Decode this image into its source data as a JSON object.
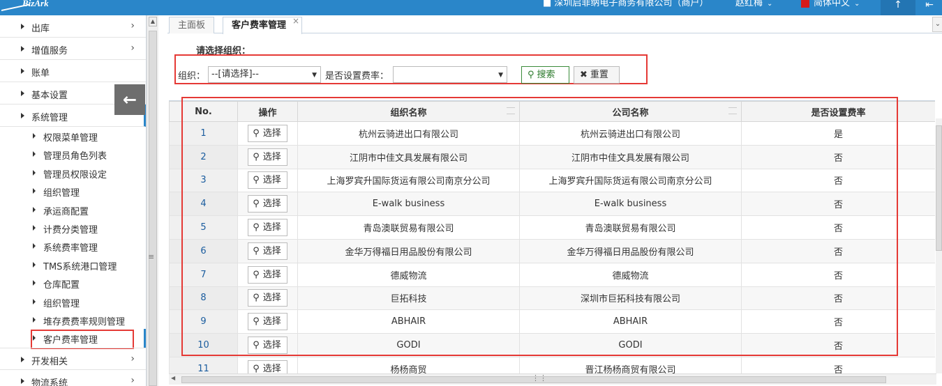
{
  "header": {
    "logo_text": "BizArk",
    "company": "深圳启菲纳电子商务有限公司（商户）",
    "user": "赵红梅",
    "language": "简体中文"
  },
  "sidebar": {
    "top_items": [
      {
        "label": "出库"
      },
      {
        "label": "增值服务"
      },
      {
        "label": "账单"
      },
      {
        "label": "基本设置"
      },
      {
        "label": "系统管理"
      }
    ],
    "sub_items": [
      {
        "label": "权限菜单管理"
      },
      {
        "label": "管理员角色列表"
      },
      {
        "label": "管理员权限设定"
      },
      {
        "label": "组织管理"
      },
      {
        "label": "承运商配置"
      },
      {
        "label": "计费分类管理"
      },
      {
        "label": "系统费率管理"
      },
      {
        "label": "TMS系统港口管理"
      },
      {
        "label": "仓库配置"
      },
      {
        "label": "组织管理"
      },
      {
        "label": "堆存费费率规则管理"
      },
      {
        "label": "客户费率管理"
      }
    ],
    "bottom_items": [
      {
        "label": "开发相关"
      },
      {
        "label": "物流系统"
      }
    ]
  },
  "tabs": [
    {
      "label": "主面板"
    },
    {
      "label": "客户费率管理"
    }
  ],
  "filter": {
    "section_title": "请选择组织：",
    "org_label": "组织：",
    "org_value": "--[请选择]--",
    "rate_label": "是否设置费率：",
    "rate_value": "",
    "search_label": "搜索",
    "reset_label": "重置"
  },
  "table": {
    "columns": [
      "No.",
      "操作",
      "组织名称",
      "公司名称",
      "是否设置费率"
    ],
    "select_label": "选择",
    "rows": [
      {
        "no": "1",
        "org": "杭州云骑进出口有限公司",
        "company": "杭州云骑进出口有限公司",
        "rate": "是"
      },
      {
        "no": "2",
        "org": "江阴市中佳文具发展有限公司",
        "company": "江阴市中佳文具发展有限公司",
        "rate": "否"
      },
      {
        "no": "3",
        "org": "上海罗宾升国际货运有限公司南京分公司",
        "company": "上海罗宾升国际货运有限公司南京分公司",
        "rate": "否"
      },
      {
        "no": "4",
        "org": "E-walk business",
        "company": "E-walk business",
        "rate": "否"
      },
      {
        "no": "5",
        "org": "青岛澳联贸易有限公司",
        "company": "青岛澳联贸易有限公司",
        "rate": "否"
      },
      {
        "no": "6",
        "org": "金华万得福日用品股份有限公司",
        "company": "金华万得福日用品股份有限公司",
        "rate": "否"
      },
      {
        "no": "7",
        "org": "德威物流",
        "company": "德威物流",
        "rate": "否"
      },
      {
        "no": "8",
        "org": "巨拓科技",
        "company": "深圳市巨拓科技有限公司",
        "rate": "否"
      },
      {
        "no": "9",
        "org": "ABHAIR",
        "company": "ABHAIR",
        "rate": "否"
      },
      {
        "no": "10",
        "org": "GODI",
        "company": "GODI",
        "rate": "否"
      },
      {
        "no": "11",
        "org": "杨杨商贸",
        "company": "晋江杨杨商贸有限公司",
        "rate": "否"
      }
    ]
  },
  "icons": {
    "search": "magnifier-icon",
    "reset": "x-icon",
    "collapse": "arrow-left-icon"
  }
}
